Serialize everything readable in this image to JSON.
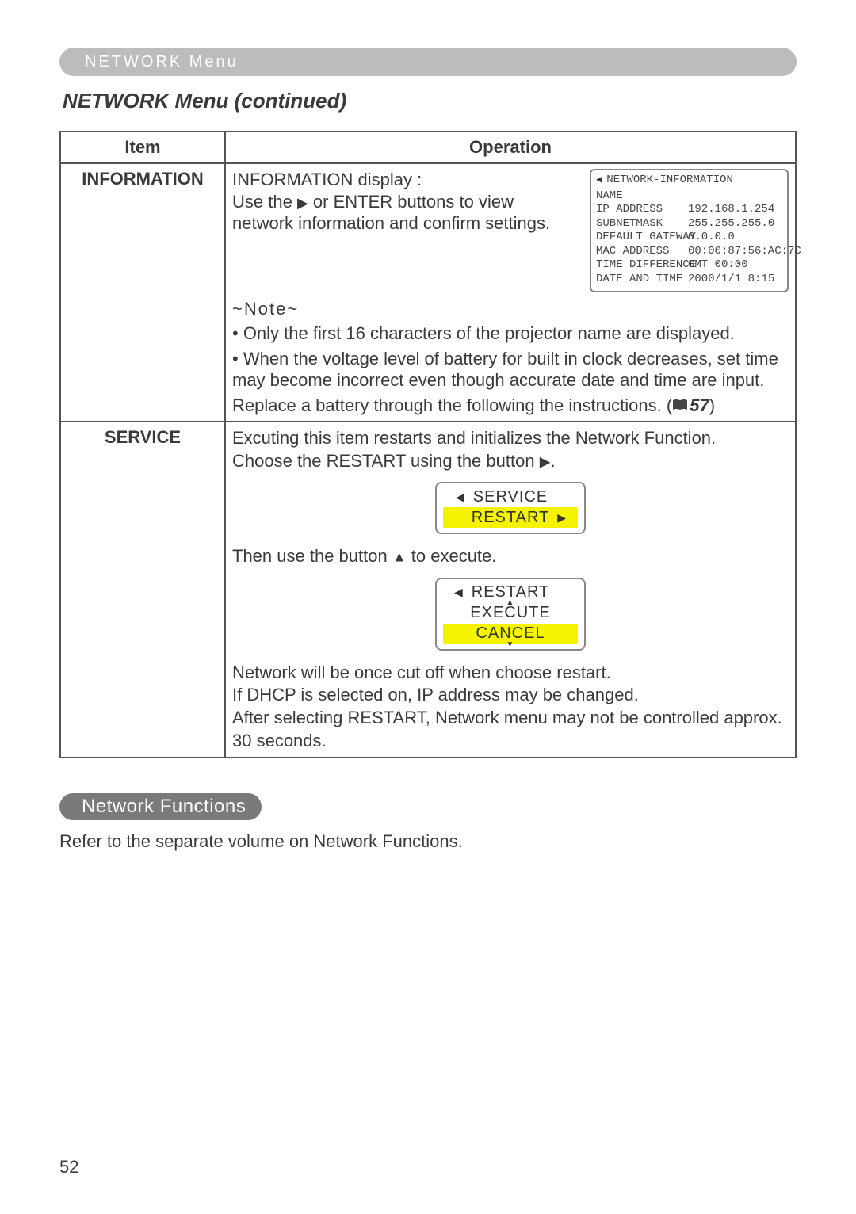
{
  "header": {
    "pill": "NETWORK Menu"
  },
  "title": "NETWORK Menu (continued)",
  "table": {
    "headers": {
      "item": "Item",
      "operation": "Operation"
    },
    "rows": [
      {
        "label": "INFORMATION",
        "info": {
          "line1": "INFORMATION display :",
          "line2_a": "Use the ",
          "line2_b": " or ENTER buttons to view",
          "line3": "network information and confirm settings."
        },
        "osd": {
          "title_arrow": "◀",
          "title": "NETWORK-INFORMATION",
          "rows": [
            {
              "k": "NAME",
              "v": ""
            },
            {
              "k": "IP ADDRESS",
              "v": "192.168.1.254"
            },
            {
              "k": "SUBNETMASK",
              "v": "255.255.255.0"
            },
            {
              "k": "DEFAULT GATEWAY",
              "v": "0.0.0.0"
            },
            {
              "k": "MAC ADDRESS",
              "v": "00:00:87:56:AC:7C"
            },
            {
              "k": "TIME DIFFERENCE",
              "v": "GMT 00:00"
            },
            {
              "k": "DATE AND TIME",
              "v": "2000/1/1  8:15"
            }
          ]
        },
        "note": {
          "head": "~Note~",
          "b1": "• Only the first 16 characters of the projector name are displayed.",
          "b2": "• When the voltage level of battery for built in clock decreases, set time may become incorrect even though accurate date and time are input.",
          "b3a": "Replace a battery through the following the instructions. (",
          "b3_num": "57",
          "b3b": ")"
        }
      },
      {
        "label": "SERVICE",
        "svc": {
          "p1": "Excuting this item restarts and initializes the Network Function.",
          "p2a": "Choose the RESTART using the button ",
          "p2b": ".",
          "osd1": {
            "top": "SERVICE",
            "bottom": "RESTART"
          },
          "p3a": "Then use the button ",
          "p3b": " to execute.",
          "osd2": {
            "top": "RESTART",
            "mid": "EXECUTE",
            "bottom": "CANCEL"
          },
          "p4": "Network will be once cut off when choose restart.",
          "p5": "If DHCP is selected on, IP address may be changed.",
          "p6": "After selecting RESTART, Network menu may not be controlled approx. 30 seconds."
        }
      }
    ]
  },
  "functions": {
    "pill": "Network Functions",
    "text": "Refer to the separate volume on Network Functions."
  },
  "page_number": "52"
}
